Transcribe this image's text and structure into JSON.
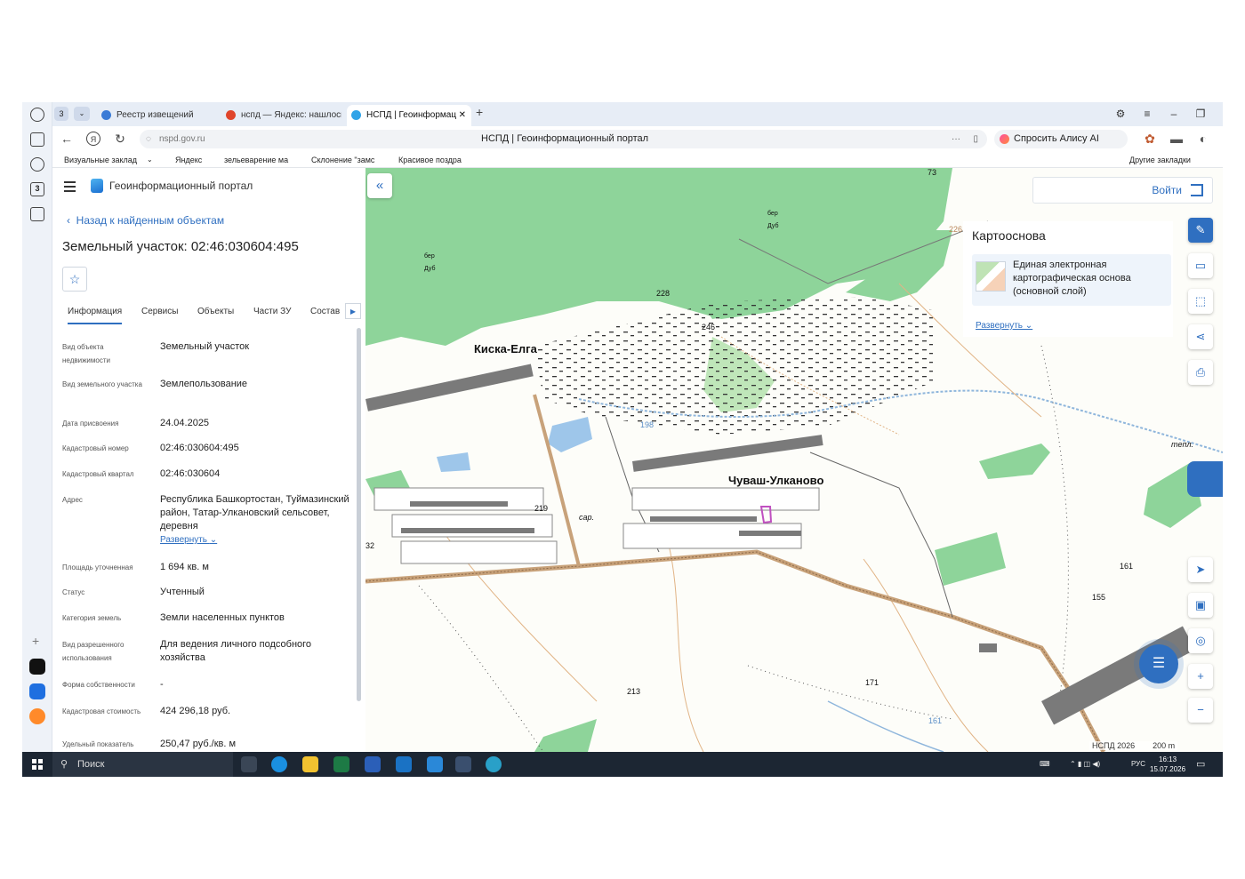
{
  "browser": {
    "tab_count": "3",
    "tabs": [
      {
        "label": "Реестр извещений"
      },
      {
        "label": "нспд — Яндекс: нашлось"
      },
      {
        "label": "НСПД | Геоинформац"
      }
    ],
    "url": "nspd.gov.ru",
    "page_title": "НСПД | Геоинформационный портал",
    "ask_alice": "Спросить Алису AI",
    "bookmarks": [
      "Визуальные заклад",
      "Яндекс",
      "зельеварение ма",
      "Склонение \"замс",
      "Красивое поздра"
    ],
    "other_bookmarks": "Другие закладки"
  },
  "portal": {
    "title": "Геоинформационный портал",
    "back_link": "Назад к найденным объектам",
    "parcel_title": "Земельный участок: 02:46:030604:495",
    "tabs": [
      "Информация",
      "Сервисы",
      "Объекты",
      "Части ЗУ",
      "Состав"
    ],
    "fields": [
      {
        "key": "Вид объекта недвижимости",
        "value": "Земельный участок"
      },
      {
        "key": "Вид земельного участка",
        "value": "Землепользование"
      },
      {
        "key": "Дата присвоения",
        "value": "24.04.2025"
      },
      {
        "key": "Кадастровый номер",
        "value": "02:46:030604:495"
      },
      {
        "key": "Кадастровый квартал",
        "value": "02:46:030604"
      },
      {
        "key": "Адрес",
        "value": "Республика Башкортостан, Туймазинский район, Татар-Улкановский сельсовет, деревня",
        "more": "Развернуть"
      },
      {
        "key": "Площадь уточненная",
        "value": "1 694 кв. м"
      },
      {
        "key": "Статус",
        "value": "Учтенный"
      },
      {
        "key": "Категория земель",
        "value": "Земли населенных пунктов"
      },
      {
        "key": "Вид разрешенного использования",
        "value": "Для ведения личного подсобного хозяйства"
      },
      {
        "key": "Форма собственности",
        "value": "-"
      },
      {
        "key": "Кадастровая стоимость",
        "value": "424 296,18 руб."
      },
      {
        "key": "Удельный показатель",
        "value": "250,47 руб./кв. м"
      }
    ]
  },
  "map": {
    "login": "Войти",
    "base_layer_heading": "Картооснова",
    "base_layer_name": "Единая электронная картографическая основа (основной слой)",
    "expand": "Развернуть",
    "places": [
      "Киска-Елга",
      "Чуваш-Улканово"
    ],
    "labels": [
      "73",
      "228",
      "246",
      "198",
      "219",
      "сар.",
      "бер",
      "Дуб",
      "бер",
      "Дуб",
      "226",
      "тепл.",
      "161",
      "155",
      "213",
      "171",
      "161",
      "32"
    ],
    "attribution": "НСПД 2026",
    "scale": "200 m",
    "colors": {
      "forest": "#8ed49a",
      "road": "#c8a27a",
      "stream": "#8fb6dc",
      "parcel": "#c050c0",
      "accent": "#2f6fc0"
    }
  },
  "taskbar": {
    "search": "Поиск",
    "lang": "РУС",
    "time": "16:13",
    "date": "15.07.2026"
  }
}
